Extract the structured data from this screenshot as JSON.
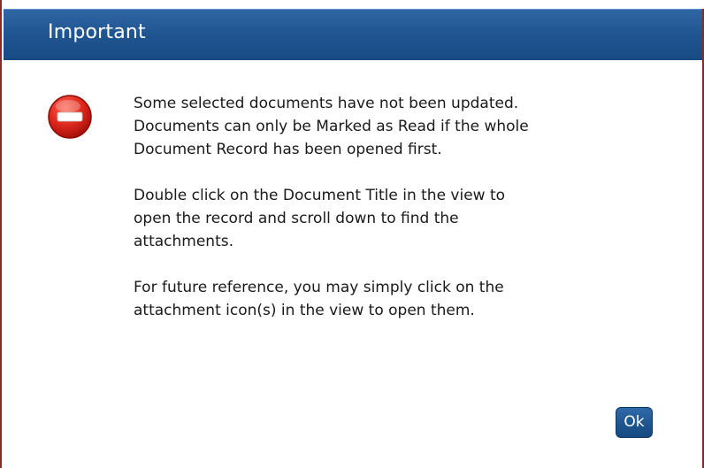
{
  "dialog": {
    "title": "Important",
    "icon": "stop-error-icon",
    "paragraphs": [
      "Some selected documents have not been updated.\nDocuments can only be Marked as Read if the whole\nDocument Record has been opened first.",
      "Double click on the Document Title in the view to\nopen the record and scroll down to find the\nattachments.",
      "For future reference, you may simply click on the\nattachment icon(s) in the view to open them."
    ],
    "ok_label": "Ok"
  },
  "colors": {
    "titlebar": "#1f5590",
    "border": "#8a2a2a",
    "error_icon": "#d42020",
    "button": "#1e5590"
  }
}
